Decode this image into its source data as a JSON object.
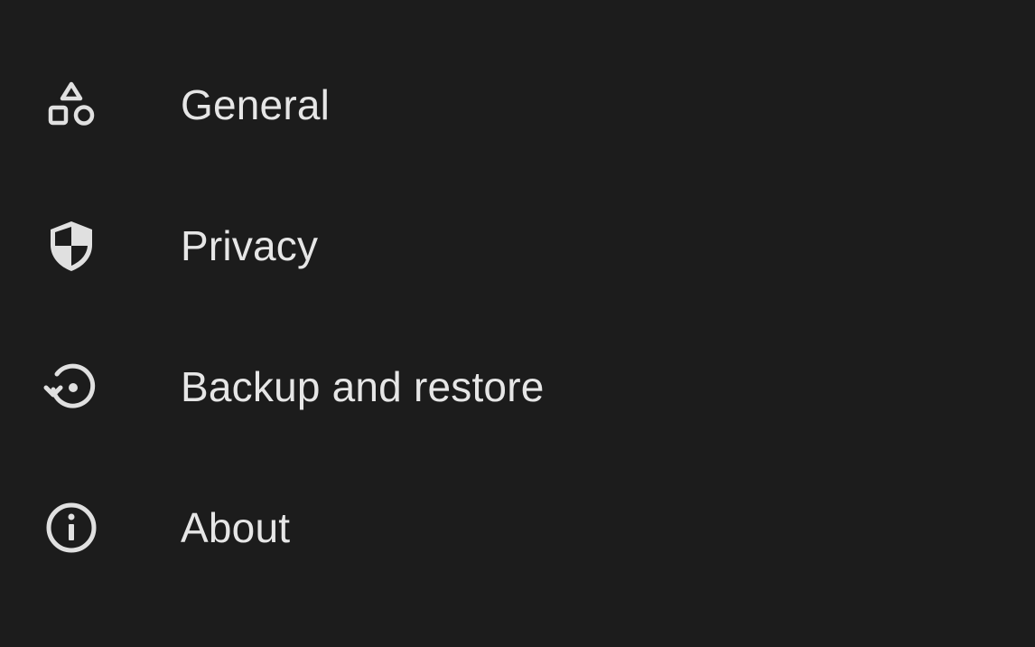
{
  "menu": {
    "items": [
      {
        "icon": "category-shapes-icon",
        "label": "General"
      },
      {
        "icon": "shield-icon",
        "label": "Privacy"
      },
      {
        "icon": "restore-history-icon",
        "label": "Backup and restore"
      },
      {
        "icon": "info-icon",
        "label": "About"
      }
    ]
  },
  "colors": {
    "background": "#1c1c1c",
    "text": "#e6e6e6",
    "icon": "#e0e0e0"
  }
}
